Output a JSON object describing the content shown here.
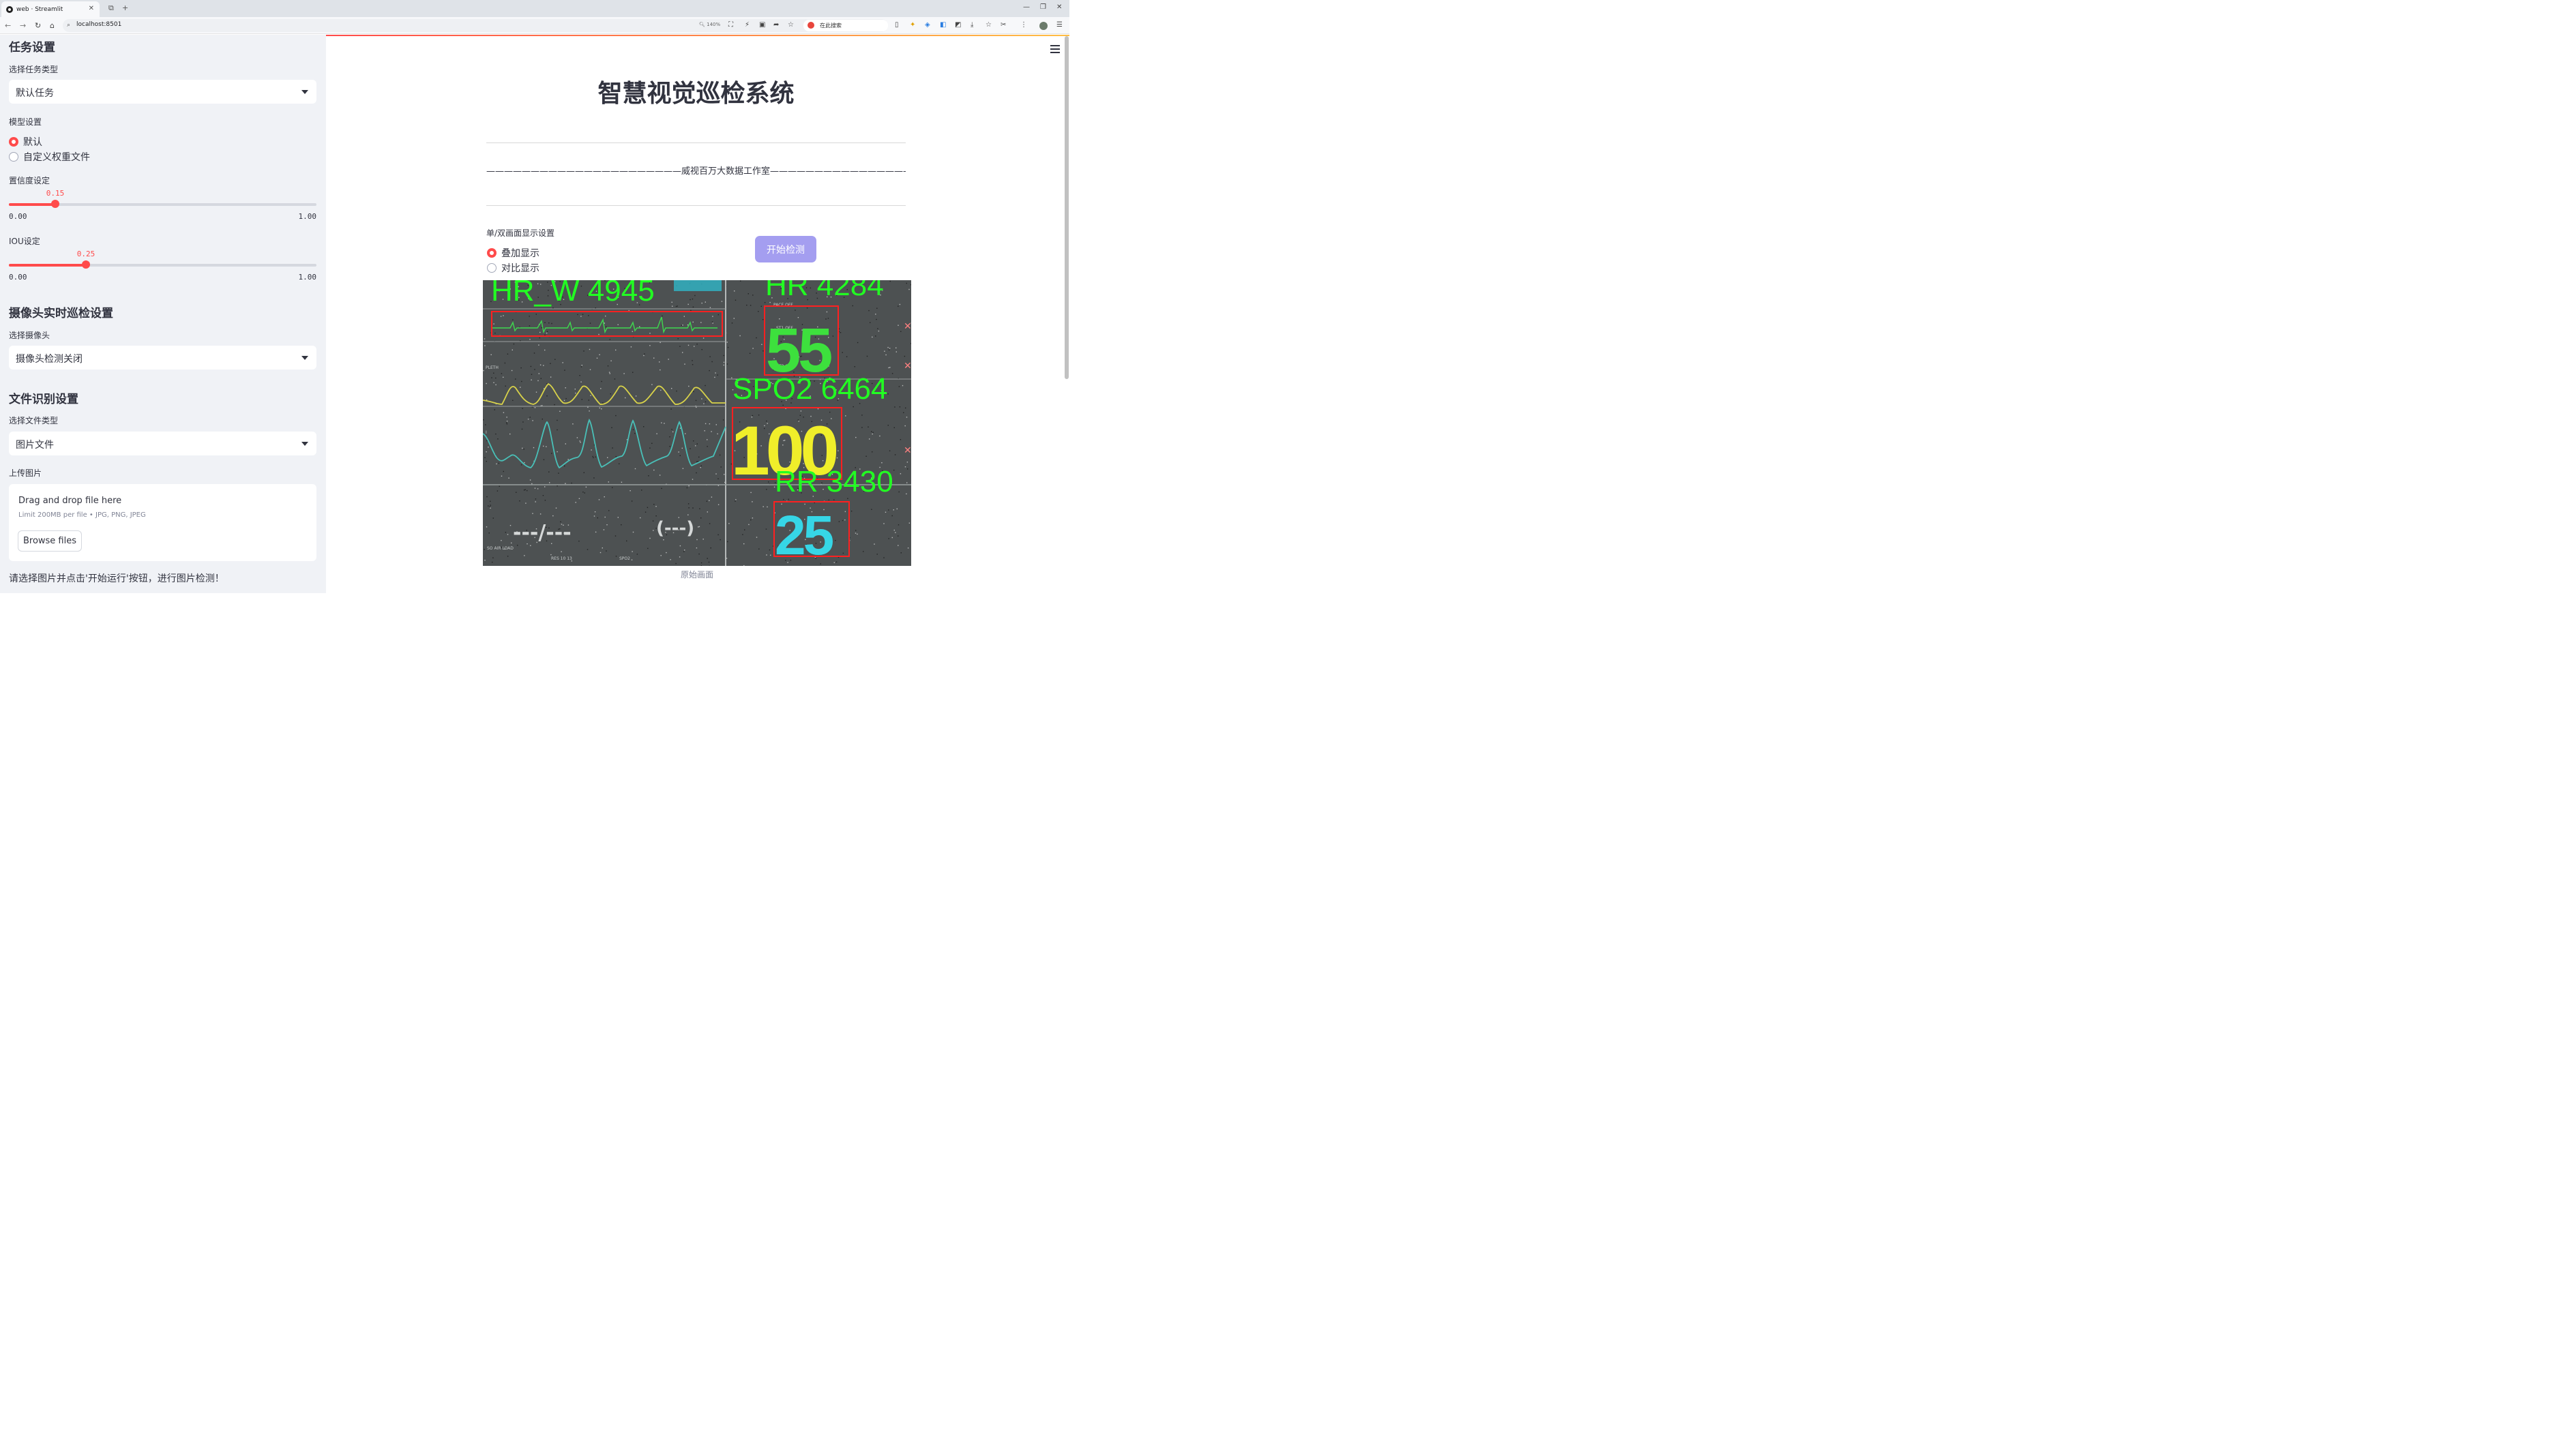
{
  "browser": {
    "tab_title": "web · Streamlit",
    "url": "localhost:8501",
    "zoom": "140%",
    "search_placeholder": "在此搜索"
  },
  "sidebar": {
    "task_heading": "任务设置",
    "task_type_label": "选择任务类型",
    "task_type_value": "默认任务",
    "model_label": "模型设置",
    "model_options": [
      "默认",
      "自定义权重文件"
    ],
    "model_selected": "默认",
    "conf_label": "置信度设定",
    "conf_value": "0.15",
    "conf_min": "0.00",
    "conf_max": "1.00",
    "conf_fraction": 0.15,
    "iou_label": "IOU设定",
    "iou_value": "0.25",
    "iou_min": "0.00",
    "iou_max": "1.00",
    "iou_fraction": 0.25,
    "camera_heading": "摄像头实时巡检设置",
    "camera_label": "选择摄像头",
    "camera_value": "摄像头检测关闭",
    "file_heading": "文件识别设置",
    "file_type_label": "选择文件类型",
    "file_type_value": "图片文件",
    "upload_label": "上传图片",
    "upload_drag": "Drag and drop file here",
    "upload_limit": "Limit 200MB per file • JPG, PNG, JPEG",
    "upload_button": "Browse files",
    "note": "请选择图片并点击'开始运行'按钮，进行图片检测！"
  },
  "main": {
    "title": "智慧视觉巡检系统",
    "credit": "——————————————————————威视百万大数据工作室———————————————————————",
    "display_label": "单/双画面显示设置",
    "display_options": [
      "叠加显示",
      "对比显示"
    ],
    "display_selected": "叠加显示",
    "start_button": "开始检测",
    "image_caption": "原始画面",
    "detections": [
      "HR_W 4945",
      "HR 4284",
      "SPO2 6464",
      "RR 3430"
    ],
    "monitor_values": [
      "55",
      "100",
      "25"
    ],
    "monitor_misc": [
      "---/---",
      "(---)"
    ]
  },
  "colors": {
    "accent": "#ff4b4b",
    "start_button": "#a49ef0",
    "box": "#ff2020",
    "label": "#22ff22"
  }
}
